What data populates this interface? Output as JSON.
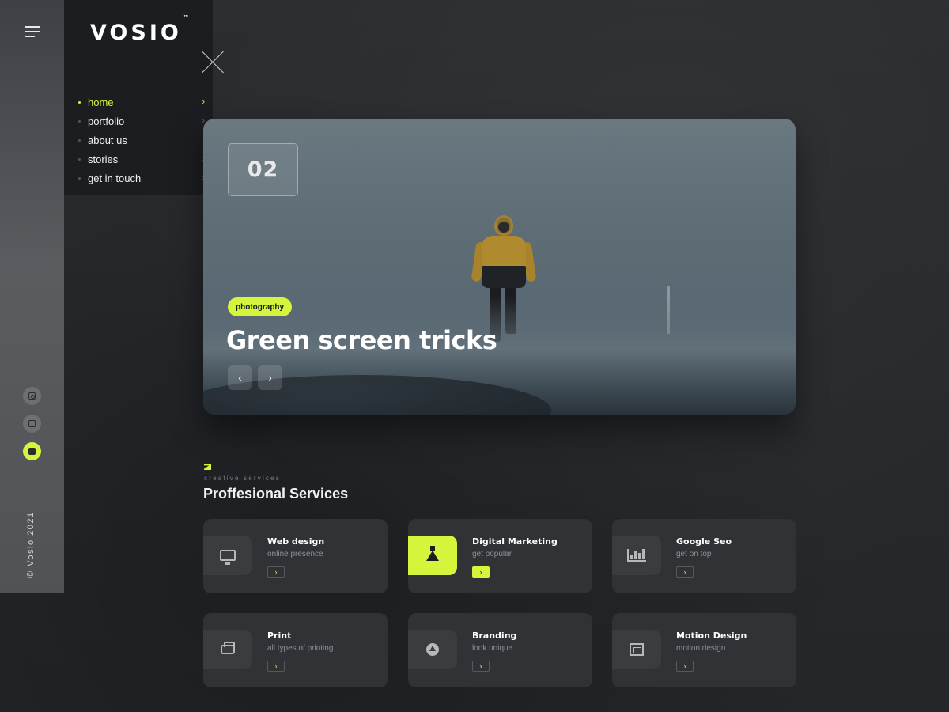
{
  "brand": {
    "name": "VOSIO",
    "tm": "™"
  },
  "sidebar": {
    "copyright": "© Vosio 2021",
    "social": [
      "instagram-icon",
      "twitter-icon",
      "facebook-icon"
    ]
  },
  "menu": {
    "items": [
      {
        "label": "home",
        "active": true,
        "has_chevron": true
      },
      {
        "label": "portfolio",
        "active": false,
        "has_chevron": true
      },
      {
        "label": "about us",
        "active": false,
        "has_chevron": false
      },
      {
        "label": "stories",
        "active": false,
        "has_chevron": true
      },
      {
        "label": "get in touch",
        "active": false,
        "has_chevron": true
      }
    ],
    "chevron": "›"
  },
  "hero": {
    "number": "02",
    "tag": "photography",
    "title": "Green screen tricks",
    "prev": "‹",
    "next": "›"
  },
  "services": {
    "kicker": "creative services",
    "title": "Proffesional Services",
    "go": "›",
    "items": [
      {
        "title": "Web design",
        "subtitle": "online presence",
        "icon": "monitor-icon",
        "highlight": false
      },
      {
        "title": "Digital Marketing",
        "subtitle": "get popular",
        "icon": "flask-icon",
        "highlight": true
      },
      {
        "title": "Google Seo",
        "subtitle": "get on top",
        "icon": "bar-chart-icon",
        "highlight": false
      },
      {
        "title": "Print",
        "subtitle": "all types of printing",
        "icon": "printer-icon",
        "highlight": false
      },
      {
        "title": "Branding",
        "subtitle": "look unique",
        "icon": "branding-icon",
        "highlight": false
      },
      {
        "title": "Motion Design",
        "subtitle": "motion design",
        "icon": "motion-icon",
        "highlight": false
      }
    ]
  },
  "colors": {
    "accent": "#d4f53c",
    "background": "#26282c",
    "panel": "#1c1d20",
    "card": "#303236"
  }
}
